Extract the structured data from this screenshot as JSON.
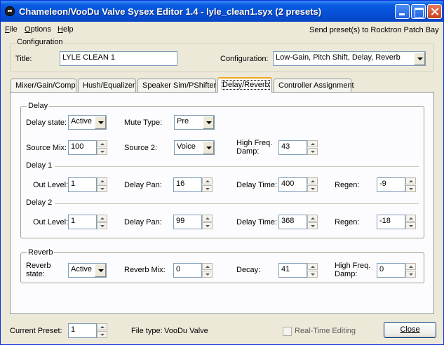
{
  "window": {
    "title": "Chameleon/VooDu Valve Sysex Editor 1.4 - lyle_clean1.syx (2 presets)"
  },
  "menu": {
    "file": "File",
    "options": "Options",
    "help": "Help",
    "send": "Send preset(s) to Rocktron Patch Bay"
  },
  "config": {
    "legend": "Configuration",
    "title_label": "Title:",
    "title_value": "LYLE CLEAN 1",
    "configuration_label": "Configuration:",
    "configuration_value": "Low-Gain, Pitch Shift, Delay, Reverb"
  },
  "tabs": [
    "Mixer/Gain/Comp",
    "Hush/Equalizer",
    "Speaker Sim/PShifter",
    "Delay/Reverb",
    "Controller Assignment"
  ],
  "active_tab": "Delay/Reverb",
  "delay": {
    "legend": "Delay",
    "state_label": "Delay state:",
    "state_value": "Active",
    "mute_label": "Mute Type:",
    "mute_value": "Pre",
    "source_mix_label": "Source Mix:",
    "source_mix_value": "100",
    "source2_label": "Source 2:",
    "source2_value": "Voice",
    "hfd_label": "High Freq. Damp:",
    "hfd_value": "43",
    "delay1": {
      "heading": "Delay 1",
      "out_label": "Out Level:",
      "out_value": "1",
      "pan_label": "Delay Pan:",
      "pan_value": "16",
      "time_label": "Delay Time:",
      "time_value": "400",
      "regen_label": "Regen:",
      "regen_value": "-9"
    },
    "delay2": {
      "heading": "Delay 2",
      "out_label": "Out Level:",
      "out_value": "1",
      "pan_label": "Delay Pan:",
      "pan_value": "99",
      "time_label": "Delay Time:",
      "time_value": "368",
      "regen_label": "Regen:",
      "regen_value": "-18"
    }
  },
  "reverb": {
    "legend": "Reverb",
    "state_label": "Reverb state:",
    "state_value": "Active",
    "mix_label": "Reverb Mix:",
    "mix_value": "0",
    "decay_label": "Decay:",
    "decay_value": "41",
    "hfd_label": "High Freq. Damp:",
    "hfd_value": "0"
  },
  "footer": {
    "current_preset_label": "Current Preset:",
    "current_preset_value": "1",
    "file_type_label": "File type:",
    "file_type_value": "VooDu Valve",
    "realtime_label": "Real-Time Editing",
    "realtime_checked": false,
    "close_label": "Close"
  }
}
